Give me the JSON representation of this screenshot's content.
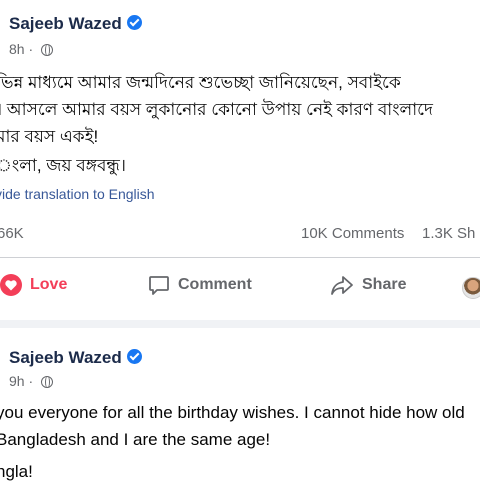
{
  "post1": {
    "author": "Sajeeb Wazed",
    "time": "8h",
    "text_lines": [
      "ভিন্ন মাধ্যমে আমার জন্মদিনের শুভেচ্ছা জানিয়েছেন, সবাইকে",
      "। আসলে আমার বয়স লুকানোর কোনো উপায় নেই কারণ বাংলাদে",
      "মার বয়স একই!",
      "ংলা, জয় বঙ্গবন্ধু।"
    ],
    "translate_link": "vide translation to English",
    "reactions_count": "66K",
    "comments_count": "10K Comments",
    "shares_count": "1.3K Sh",
    "actions": {
      "love": "Love",
      "comment": "Comment",
      "share": "Share"
    }
  },
  "post2": {
    "author": "Sajeeb Wazed",
    "time": "9h",
    "text_lines": [
      " you everyone for all the birthday wishes. I cannot hide how old",
      " Bangladesh and I are the same age!",
      "ngla!"
    ]
  },
  "colors": {
    "link": "#385898",
    "love": "#f33e58",
    "verified": "#1877f2",
    "author": "#1c2b4a"
  },
  "icons": [
    "verified-icon",
    "globe-icon",
    "heart-icon",
    "comment-icon",
    "share-icon"
  ]
}
